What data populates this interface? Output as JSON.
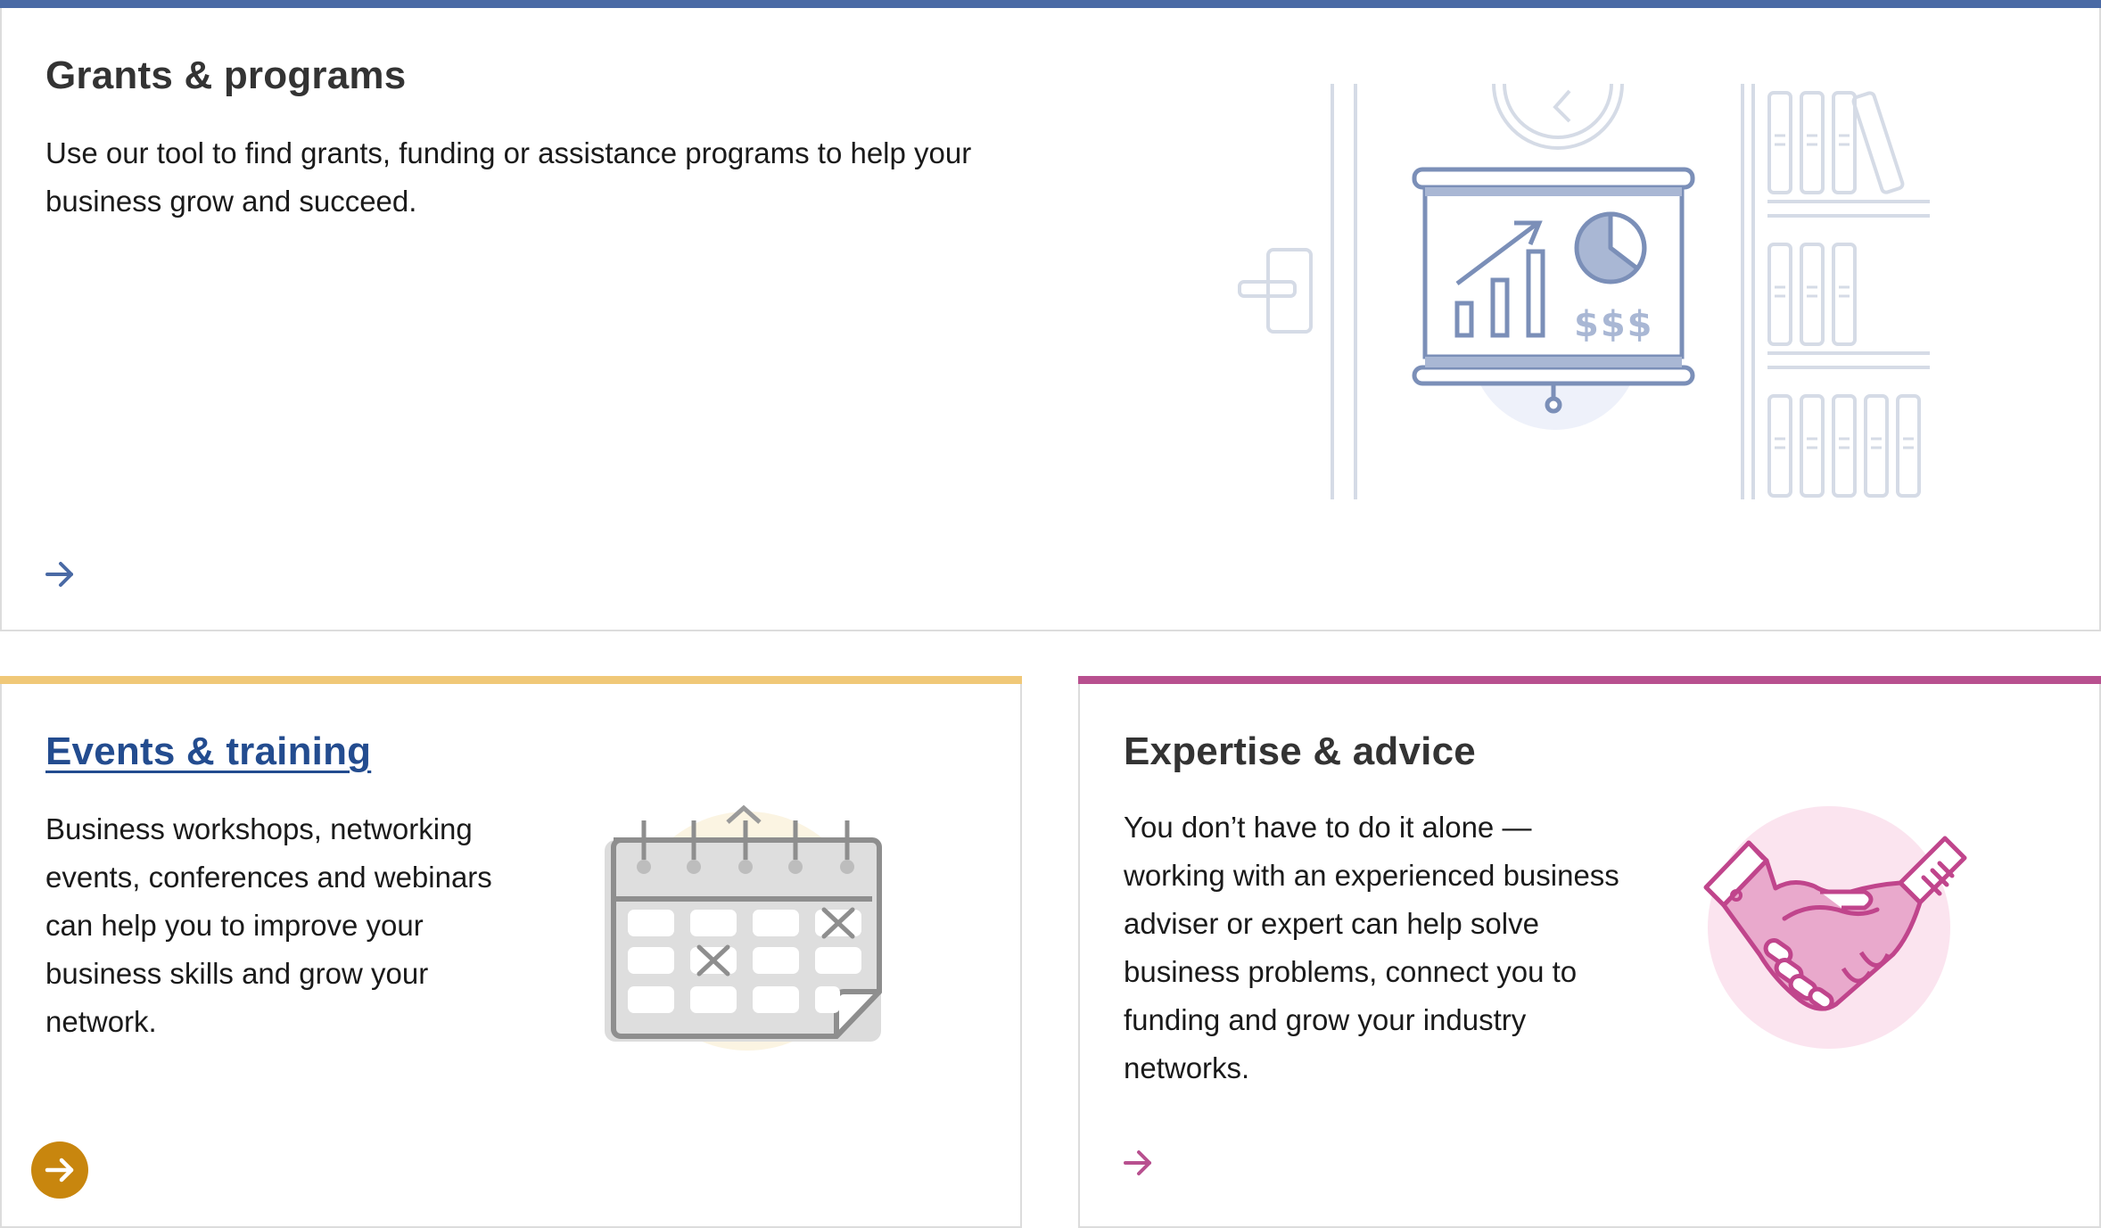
{
  "cards": {
    "grants": {
      "title": "Grants & programs",
      "description": "Use our tool to find grants, funding or assistance programs to help your business grow and succeed.",
      "accent": "#4a6aa5",
      "icon": "arrow-right-icon",
      "illustration": "presentation-board-illustration"
    },
    "events": {
      "title": "Events & training",
      "description": "Business workshops, networking events, conferences and webinars can help you to improve your business skills and grow your network.",
      "accent": "#f0c878",
      "button_color": "#c8860e",
      "icon": "arrow-right-circle-icon",
      "illustration": "calendar-illustration"
    },
    "expertise": {
      "title": "Expertise & advice",
      "description": "You don’t have to do it alone — working with an experienced business adviser or expert can help solve business problems, connect you to funding and grow your industry networks.",
      "accent": "#b8508f",
      "icon": "arrow-right-icon",
      "illustration": "handshake-illustration"
    }
  }
}
